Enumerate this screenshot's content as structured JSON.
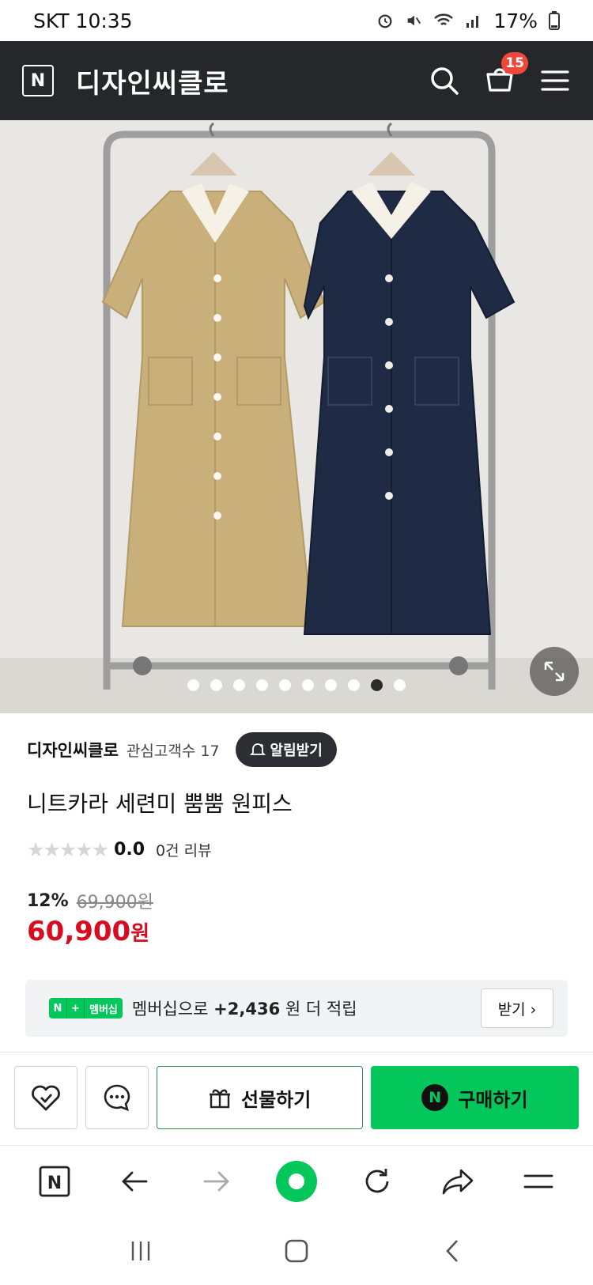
{
  "status": {
    "carrier_time": "SKT 10:35",
    "battery": "17%"
  },
  "topbar": {
    "logo_letter": "N",
    "store_name": "디자인씨클로",
    "cart_count": "15"
  },
  "hero": {
    "slide_count": 10,
    "active_slide": 9,
    "colors": {
      "left_dress": "#c9b07a",
      "right_dress": "#1f2a44"
    }
  },
  "seller": {
    "name": "디자인씨클로",
    "fans": "관심고객수 17",
    "alarm_label": "알림받기"
  },
  "product": {
    "title": "니트카라 세련미 뿜뿜 원피스"
  },
  "rating": {
    "stars": "★★★★★",
    "value": "0.0",
    "reviews": "0건 리뷰"
  },
  "price": {
    "discount": "12%",
    "original": "69,900원",
    "sale": "60,900",
    "sale_unit": "원"
  },
  "membership": {
    "tag_n": "N",
    "tag_plus": "+",
    "tag_label": "멤버십",
    "text_prefix": "멤버십으로 ",
    "points": "+2,436",
    "text_suffix": "원 더 적립",
    "receive_label": "받기 ›"
  },
  "actions": {
    "gift_label": "선물하기",
    "buy_label": "구매하기",
    "buy_logo": "N"
  },
  "colors": {
    "accent_green": "#03c75a",
    "sale_red": "#d90b20",
    "topbar": "#26272b"
  }
}
